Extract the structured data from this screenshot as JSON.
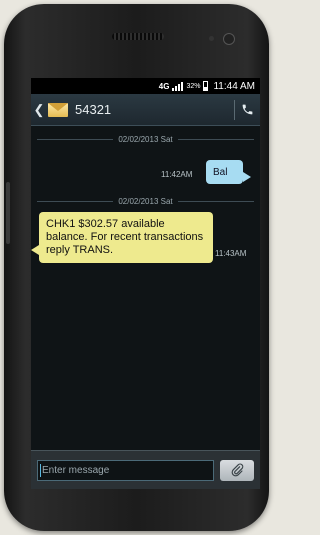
{
  "status_bar": {
    "network": "4G",
    "battery": "32%",
    "battery_level": 0.32,
    "time": "11:44 AM"
  },
  "title_bar": {
    "contact": "54321"
  },
  "thread": [
    {
      "type": "date",
      "label": "02/02/2013 Sat"
    },
    {
      "type": "sent",
      "text": "Bal",
      "time": "11:42AM"
    },
    {
      "type": "date",
      "label": "02/02/2013 Sat"
    },
    {
      "type": "received",
      "text": "CHK1 $302.57 available balance. For recent transactions reply TRANS.",
      "time": "11:43AM"
    }
  ],
  "compose": {
    "placeholder": "Enter message"
  },
  "colors": {
    "sent_bubble": "#a7dcf2",
    "received_bubble": "#eeea8e",
    "screen_bg": "#0f1416"
  }
}
